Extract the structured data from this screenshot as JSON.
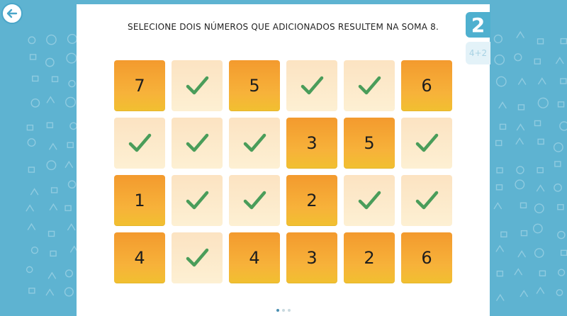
{
  "instruction": "SELECIONE DOIS NÚMEROS QUE ADICIONADOS RESULTEM NA SOMA 8.",
  "level": {
    "current": "2",
    "next": "4+2"
  },
  "colors": {
    "background": "#5eb3d1",
    "tile_active": "#f5a332",
    "tile_done": "#fdebcc",
    "check": "#4a9d5a",
    "badge": "#4fb0cf"
  },
  "grid": {
    "rows": [
      [
        {
          "state": "number",
          "value": "7"
        },
        {
          "state": "checked",
          "value": "check-icon"
        },
        {
          "state": "number",
          "value": "5"
        },
        {
          "state": "checked",
          "value": "check-icon"
        },
        {
          "state": "checked",
          "value": "check-icon"
        },
        {
          "state": "number",
          "value": "6"
        }
      ],
      [
        {
          "state": "checked",
          "value": "check-icon"
        },
        {
          "state": "checked",
          "value": "check-icon"
        },
        {
          "state": "checked",
          "value": "check-icon"
        },
        {
          "state": "number",
          "value": "3"
        },
        {
          "state": "number",
          "value": "5"
        },
        {
          "state": "checked",
          "value": "check-icon"
        }
      ],
      [
        {
          "state": "number",
          "value": "1"
        },
        {
          "state": "checked",
          "value": "check-icon"
        },
        {
          "state": "checked",
          "value": "check-icon"
        },
        {
          "state": "number",
          "value": "2"
        },
        {
          "state": "checked",
          "value": "check-icon"
        },
        {
          "state": "checked",
          "value": "check-icon"
        }
      ],
      [
        {
          "state": "number",
          "value": "4"
        },
        {
          "state": "checked",
          "value": "check-icon"
        },
        {
          "state": "number",
          "value": "4"
        },
        {
          "state": "number",
          "value": "3"
        },
        {
          "state": "number",
          "value": "2"
        },
        {
          "state": "number",
          "value": "6"
        }
      ]
    ]
  },
  "pagination": {
    "total": 3,
    "active": 1
  }
}
